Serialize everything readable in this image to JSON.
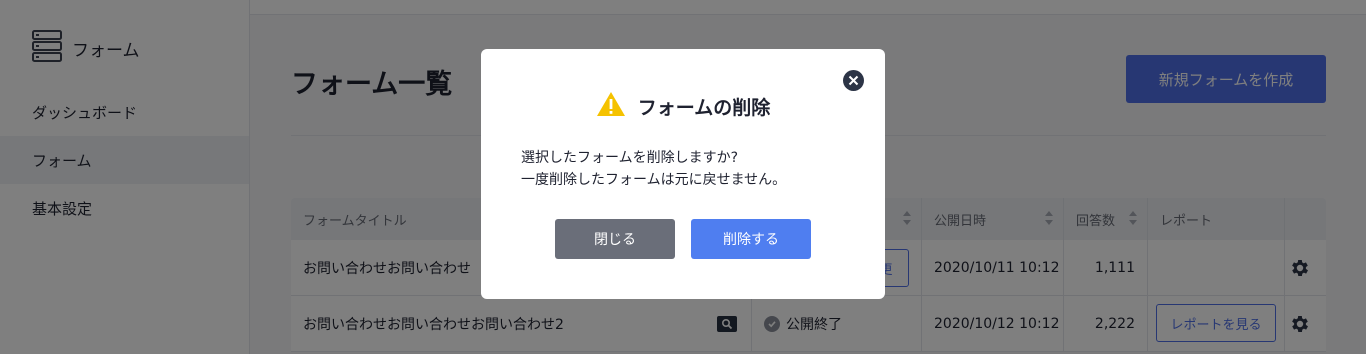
{
  "sidebar": {
    "brand_icon": "server-stack-icon",
    "brand_label": "フォーム",
    "items": [
      {
        "label": "ダッシュボード"
      },
      {
        "label": "フォーム"
      },
      {
        "label": "基本設定"
      }
    ]
  },
  "main": {
    "title": "フォーム一覧",
    "create_button": "新規フォームを作成"
  },
  "table": {
    "headers": [
      "フォームタイトル",
      "",
      "公開日時",
      "回答数",
      "レポート"
    ],
    "rows": [
      {
        "title": "お問い合わせお問い合わせ",
        "status": "更",
        "date": "2020/10/11 10:12",
        "count": "1,111",
        "report": ""
      },
      {
        "title": "お問い合わせお問い合わせお問い合わせ2",
        "status": "公開終了",
        "date": "2020/10/12 10:12",
        "count": "2,222",
        "report": "レポートを見る"
      }
    ]
  },
  "modal": {
    "title": "フォームの削除",
    "warning_icon": "warning-icon",
    "close_icon": "close-icon",
    "body_line1": "選択したフォームを削除しますか?",
    "body_line2": "一度削除したフォームは元に戻せません。",
    "close_button": "閉じる",
    "delete_button": "削除する"
  },
  "colors": {
    "accent": "#4f7ef0",
    "primary": "#4f6fe6",
    "warning": "#f5c200",
    "overlay": "rgba(0,0,0,0.5)"
  }
}
